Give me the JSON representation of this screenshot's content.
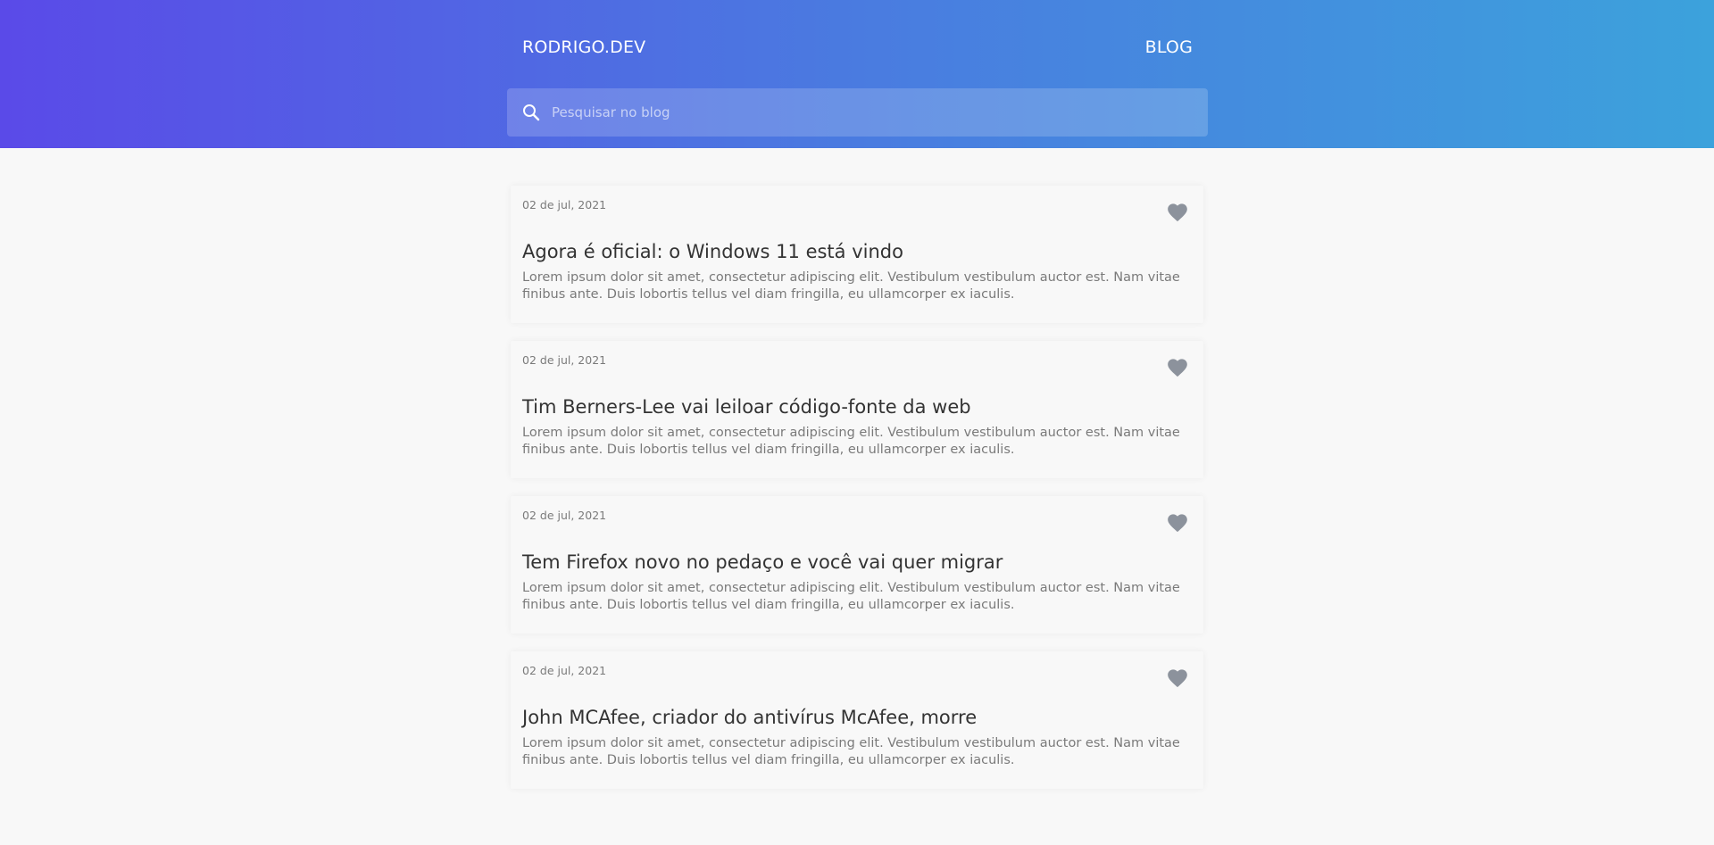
{
  "header": {
    "brand": "RODRIGO.DEV",
    "nav_blog": "BLOG",
    "search": {
      "placeholder": "Pesquisar no blog",
      "value": ""
    },
    "gradient": [
      "#5a4ae8",
      "#4a7be0",
      "#3ca2dc"
    ]
  },
  "posts": [
    {
      "date": "02 de jul, 2021",
      "title": "Agora é oficial: o Windows 11 está vindo",
      "excerpt": "Lorem ipsum dolor sit amet, consectetur adipiscing elit. Vestibulum vestibulum auctor est. Nam vitae finibus ante. Duis lobortis tellus vel diam fringilla, eu ullamcorper ex iaculis."
    },
    {
      "date": "02 de jul, 2021",
      "title": "Tim Berners-Lee vai leiloar código-fonte da web",
      "excerpt": "Lorem ipsum dolor sit amet, consectetur adipiscing elit. Vestibulum vestibulum auctor est. Nam vitae finibus ante. Duis lobortis tellus vel diam fringilla, eu ullamcorper ex iaculis."
    },
    {
      "date": "02 de jul, 2021",
      "title": "Tem Firefox novo no pedaço e você vai quer migrar",
      "excerpt": "Lorem ipsum dolor sit amet, consectetur adipiscing elit. Vestibulum vestibulum auctor est. Nam vitae finibus ante. Duis lobortis tellus vel diam fringilla, eu ullamcorper ex iaculis."
    },
    {
      "date": "02 de jul, 2021",
      "title": "John MCAfee, criador do antivírus McAfee, morre",
      "excerpt": "Lorem ipsum dolor sit amet, consectetur adipiscing elit. Vestibulum vestibulum auctor est. Nam vitae finibus ante. Duis lobortis tellus vel diam fringilla, eu ullamcorper ex iaculis."
    }
  ],
  "icons": {
    "search": "search-icon",
    "like": "heart-icon"
  },
  "colors": {
    "heart": "#8c929c",
    "background": "#f8f8f8",
    "text": "#333333",
    "muted": "#7a7a7a"
  }
}
